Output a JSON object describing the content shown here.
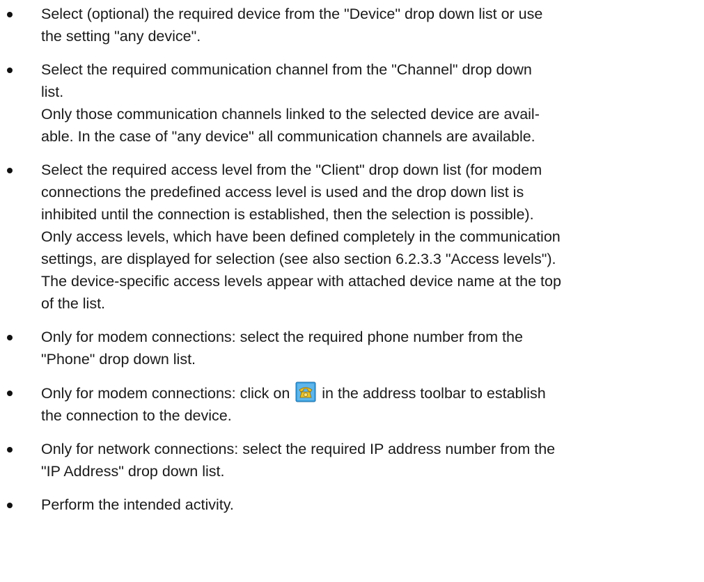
{
  "items": [
    {
      "lines": [
        "Select (optional) the required device from the \"Device\" drop down list or use",
        "the setting \"any device\"."
      ]
    },
    {
      "lines": [
        "Select the required communication channel from the \"Channel\" drop down",
        "list.",
        "Only those communication channels linked to the selected device are avail-",
        "able. In the case of \"any device\" all communication channels are available."
      ]
    },
    {
      "lines": [
        "Select the required access level from the \"Client\" drop down list (for modem",
        "connections the predefined access level is used and the drop down list is",
        "inhibited until the connection is established, then the selection is possible).",
        "Only access levels, which have been defined completely in the communication",
        "settings, are displayed for selection (see also section 6.2.3.3 \"Access levels\").",
        "The device-specific access levels appear with attached device name at the top",
        "of the list."
      ]
    },
    {
      "lines": [
        "Only for modem connections: select the required phone number from the",
        "\"Phone\" drop down list."
      ]
    },
    {
      "before_icon": "Only for modem connections: click on",
      "icon": "phone-dial-icon",
      "after_icon": "in the address toolbar to establish",
      "line2": "the connection to the device."
    },
    {
      "lines": [
        "Only for network connections: select the required IP address number from the",
        "\"IP Address\" drop down list."
      ]
    },
    {
      "lines": [
        "Perform the intended activity."
      ]
    }
  ],
  "colors": {
    "icon_background": "#3aa0e0",
    "icon_phone": "#e8c22a"
  }
}
